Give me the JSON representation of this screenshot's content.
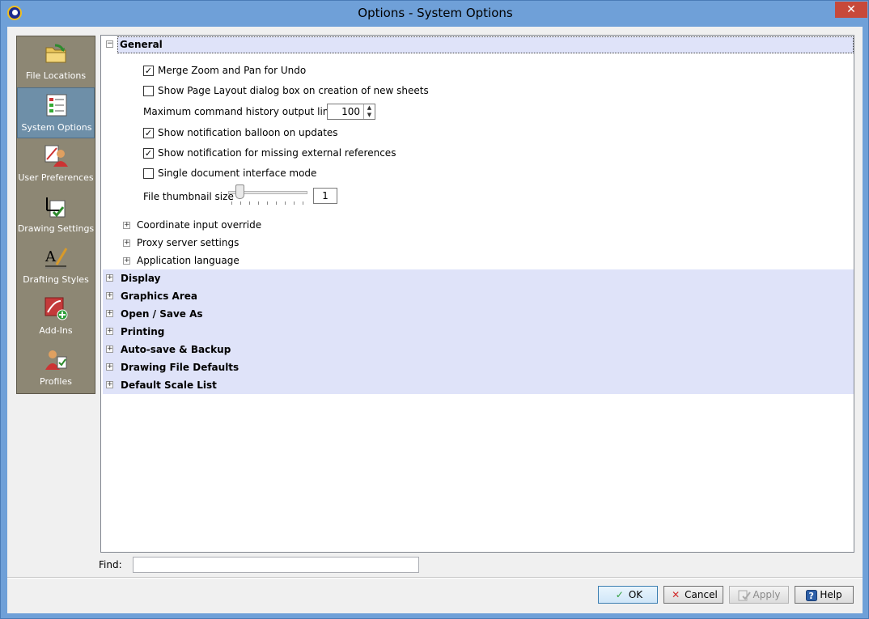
{
  "window": {
    "title": "Options - System Options",
    "close_glyph": "✕"
  },
  "nav": {
    "items": [
      {
        "label": "File Locations",
        "icon": "folder-icon"
      },
      {
        "label": "System Options",
        "icon": "checklist-icon",
        "selected": true
      },
      {
        "label": "User Preferences",
        "icon": "user-preferences-icon"
      },
      {
        "label": "Drawing Settings",
        "icon": "drawing-settings-icon"
      },
      {
        "label": "Drafting Styles",
        "icon": "drafting-styles-icon"
      },
      {
        "label": "Add-Ins",
        "icon": "add-ins-icon"
      },
      {
        "label": "Profiles",
        "icon": "profiles-icon"
      }
    ]
  },
  "tree": {
    "general": {
      "label": "General",
      "options": {
        "merge_zoom": {
          "label": "Merge Zoom and Pan for Undo",
          "checked": true
        },
        "page_layout": {
          "label": "Show Page Layout dialog box on creation of new sheets",
          "checked": false
        },
        "history_lines": {
          "label": "Maximum command history output lines:",
          "value": "100"
        },
        "balloon": {
          "label": "Show notification balloon on updates",
          "checked": true
        },
        "missing_refs": {
          "label": "Show notification for missing external references",
          "checked": true
        },
        "sdi": {
          "label": "Single document interface mode",
          "checked": false
        },
        "thumbnail": {
          "label": "File thumbnail size",
          "value": "1"
        }
      },
      "subsections": [
        "Coordinate input override",
        "Proxy server settings",
        "Application language"
      ]
    },
    "sections": [
      "Display",
      "Graphics Area",
      "Open / Save As",
      "Printing",
      "Auto-save & Backup",
      "Drawing File Defaults",
      "Default Scale List"
    ],
    "expand_glyph": "+",
    "collapse_glyph": "−",
    "check_glyph": "✓"
  },
  "find": {
    "label": "Find:",
    "value": ""
  },
  "buttons": {
    "ok": "OK",
    "cancel": "Cancel",
    "apply": "Apply",
    "help": "Help"
  },
  "colors": {
    "section_bg": "#dfe3f9",
    "nav_bg": "#8d8774",
    "nav_selected": "#6e8fa8",
    "title_bar": "#6fa0d8"
  }
}
